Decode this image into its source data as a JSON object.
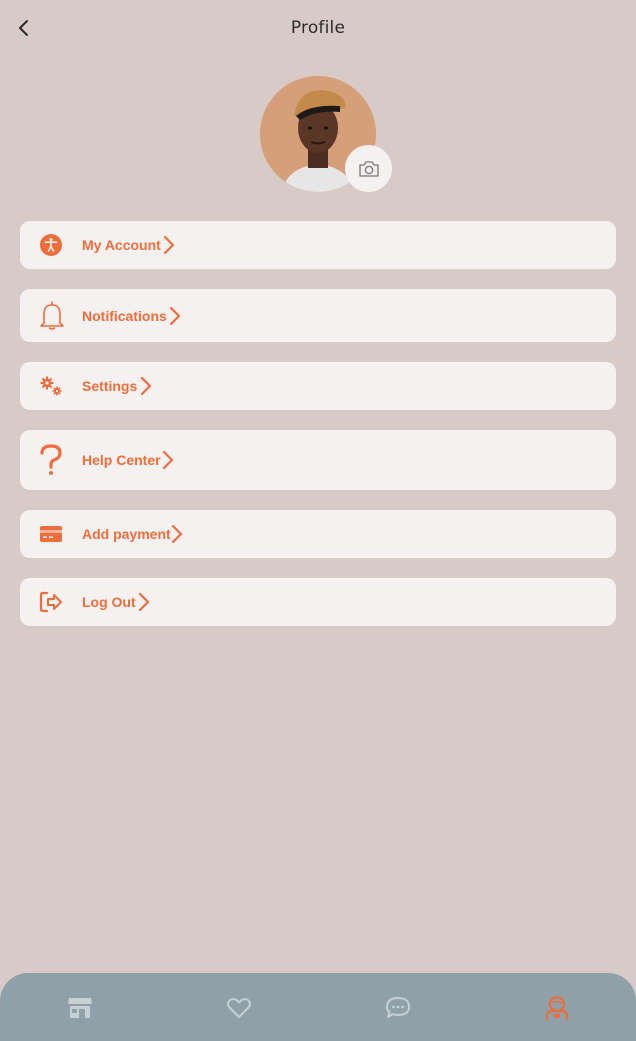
{
  "header": {
    "title": "Profile"
  },
  "menu": {
    "items": [
      {
        "label": "My Account",
        "icon": "accessibility-icon"
      },
      {
        "label": "Notifications",
        "icon": "bell-icon"
      },
      {
        "label": "Settings",
        "icon": "gears-icon"
      },
      {
        "label": "Help Center",
        "icon": "question-icon"
      },
      {
        "label": "Add payment",
        "icon": "credit-card-icon"
      },
      {
        "label": "Log Out",
        "icon": "logout-icon"
      }
    ]
  },
  "bottom_nav": {
    "items": [
      {
        "icon": "store-icon",
        "active": false
      },
      {
        "icon": "heart-icon",
        "active": false
      },
      {
        "icon": "chat-icon",
        "active": false
      },
      {
        "icon": "profile-icon",
        "active": true
      }
    ]
  },
  "colors": {
    "background": "#d8cbc7",
    "card": "#f4f1f0",
    "accent": "#ef6d3a",
    "nav_bar": "#8fa0a8",
    "nav_icon_inactive": "#c5cfd4"
  }
}
